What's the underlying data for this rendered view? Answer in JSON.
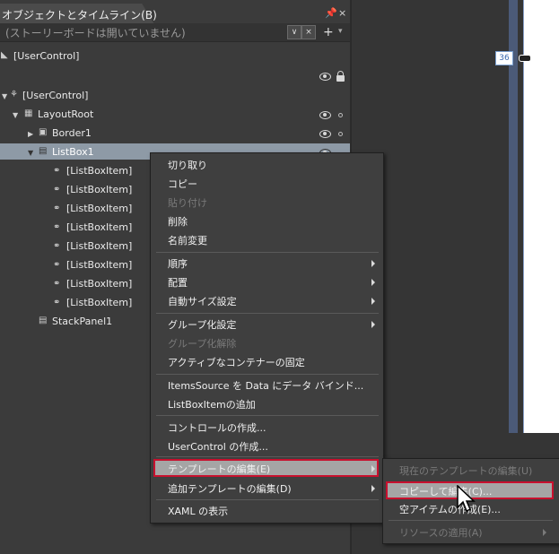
{
  "panel": {
    "title": "オブジェクトとタイムライン(B)",
    "pin_icon": "pin-icon",
    "close_label": "×",
    "storyboard_placeholder": "(ストーリーボードは開いていません)",
    "toolbar_buttons": [
      "∨",
      "×",
      "+",
      "▾"
    ]
  },
  "tree": {
    "root_scene": "[UserControl]",
    "root": "[UserControl]",
    "layout_root": "LayoutRoot",
    "border": "Border1",
    "listbox": "ListBox1",
    "items": [
      "[ListBoxItem]",
      "[ListBoxItem]",
      "[ListBoxItem]",
      "[ListBoxItem]",
      "[ListBoxItem]",
      "[ListBoxItem]",
      "[ListBoxItem]",
      "[ListBoxItem]"
    ],
    "stackpanel": "StackPanel1"
  },
  "canvas": {
    "number": "36"
  },
  "context_menu": {
    "items": [
      {
        "label": "切り取り",
        "enabled": true
      },
      {
        "label": "コピー",
        "enabled": true
      },
      {
        "label": "貼り付け",
        "enabled": false
      },
      {
        "label": "削除",
        "enabled": true
      },
      {
        "label": "名前変更",
        "enabled": true
      },
      {
        "label": "順序",
        "enabled": true,
        "submenu": true
      },
      {
        "label": "配置",
        "enabled": true,
        "submenu": true
      },
      {
        "label": "自動サイズ設定",
        "enabled": true,
        "submenu": true
      },
      {
        "label": "グループ化設定",
        "enabled": true,
        "submenu": true
      },
      {
        "label": "グループ化解除",
        "enabled": false
      },
      {
        "label": "アクティブなコンテナーの固定",
        "enabled": true
      },
      {
        "label": "ItemsSource を Data にデータ バインド...",
        "enabled": true
      },
      {
        "label": "ListBoxItemの追加",
        "enabled": true
      },
      {
        "label": "コントロールの作成...",
        "enabled": true
      },
      {
        "label": "UserControl の作成...",
        "enabled": true
      },
      {
        "label": "テンプレートの編集(E)",
        "enabled": true,
        "submenu": true,
        "highlighted": true
      },
      {
        "label": "追加テンプレートの編集(D)",
        "enabled": true,
        "submenu": true
      },
      {
        "label": "XAML の表示",
        "enabled": true
      }
    ]
  },
  "submenu": {
    "items": [
      {
        "label": "現在のテンプレートの編集(U)",
        "enabled": false
      },
      {
        "label": "コピーして編集(C)...",
        "enabled": true,
        "highlighted": true
      },
      {
        "label": "空アイテムの作成(E)...",
        "enabled": true
      },
      {
        "label": "リソースの適用(A)",
        "enabled": false,
        "submenu": true
      }
    ]
  },
  "colors": {
    "highlight_border": "#c8102e",
    "selection": "#8e9aa6"
  }
}
